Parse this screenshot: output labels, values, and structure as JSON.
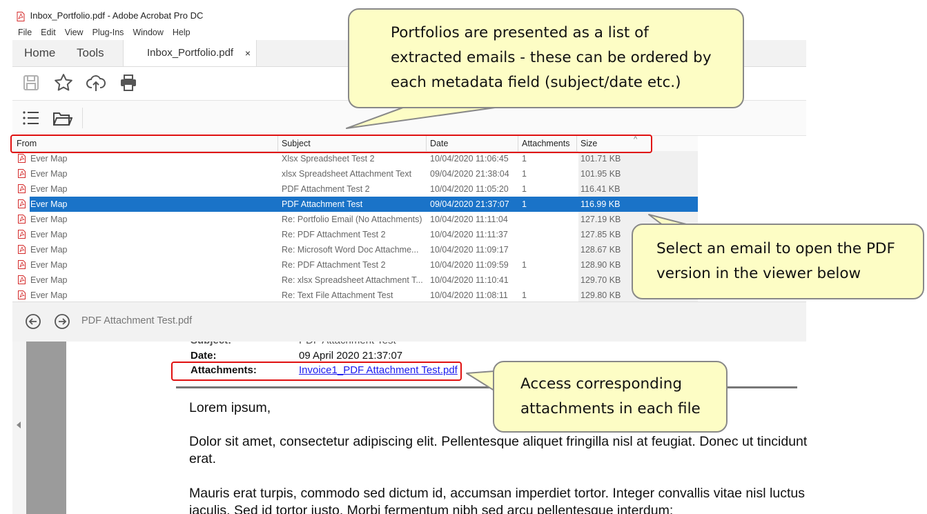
{
  "window": {
    "title": "Inbox_Portfolio.pdf - Adobe Acrobat Pro DC"
  },
  "menu": [
    "File",
    "Edit",
    "View",
    "Plug-Ins",
    "Window",
    "Help"
  ],
  "tabs": {
    "home": "Home",
    "tools": "Tools",
    "document": "Inbox_Portfolio.pdf",
    "close": "×"
  },
  "toolbar_icons": [
    "save-icon",
    "star-icon",
    "upload-cloud-icon",
    "print-icon"
  ],
  "portfolio_icons": [
    "list-view-icon",
    "open-folder-icon"
  ],
  "table": {
    "columns": {
      "from": "From",
      "subject": "Subject",
      "date": "Date",
      "attachments": "Attachments",
      "size": "Size",
      "sort_indicator": "^"
    },
    "rows": [
      {
        "from": "Ever Map",
        "subject": "Xlsx Spreadsheet Test 2",
        "date": "10/04/2020 11:06:45",
        "attachments": "1",
        "size": "101.71 KB"
      },
      {
        "from": "Ever Map",
        "subject": "xlsx Spreadsheet Attachment Text",
        "date": "09/04/2020 21:38:04",
        "attachments": "1",
        "size": "101.95 KB"
      },
      {
        "from": "Ever Map",
        "subject": "PDF Attachment Test 2",
        "date": "10/04/2020 11:05:20",
        "attachments": "1",
        "size": "116.41 KB"
      },
      {
        "from": "Ever Map",
        "subject": "PDF Attachment Test",
        "date": "09/04/2020 21:37:07",
        "attachments": "1",
        "size": "116.99 KB"
      },
      {
        "from": "Ever Map",
        "subject": "Re: Portfolio Email (No Attachments)",
        "date": "10/04/2020 11:11:04",
        "attachments": "",
        "size": "127.19 KB"
      },
      {
        "from": "Ever Map",
        "subject": "Re: PDF Attachment Test 2",
        "date": "10/04/2020 11:11:37",
        "attachments": "",
        "size": "127.85 KB"
      },
      {
        "from": "Ever Map",
        "subject": "Re: Microsoft Word Doc Attachme...",
        "date": "10/04/2020 11:09:17",
        "attachments": "",
        "size": "128.67 KB"
      },
      {
        "from": "Ever Map",
        "subject": "Re: PDF Attachment Test 2",
        "date": "10/04/2020 11:09:59",
        "attachments": "1",
        "size": "128.90 KB"
      },
      {
        "from": "Ever Map",
        "subject": "Re: xlsx Spreadsheet Attachment T...",
        "date": "10/04/2020 11:10:41",
        "attachments": "",
        "size": "129.70 KB"
      },
      {
        "from": "Ever Map",
        "subject": "Re: Text File Attachment Test",
        "date": "10/04/2020 11:08:11",
        "attachments": "1",
        "size": "129.80 KB"
      }
    ],
    "selected_row_index": 3
  },
  "navigation": {
    "file_name": "PDF Attachment Test.pdf"
  },
  "document": {
    "subject_label": "Subject:",
    "subject_value": "PDF Attachment Test",
    "date_label": "Date:",
    "date_value": "09 April 2020 21:37:07",
    "attachments_label": "Attachments:",
    "attachments_link": "Invoice1_PDF Attachment Test.pdf",
    "greeting": "Lorem ipsum,",
    "paragraph1": "Dolor sit amet, consectetur adipiscing elit. Pellentesque aliquet fringilla nisl at feugiat. Donec ut tincidunt erat.",
    "paragraph2": "Mauris erat turpis, commodo sed dictum id, accumsan imperdiet tortor. Integer convallis vitae nisl luctus iaculis. Sed id tortor justo. Morbi fermentum nibh sed arcu pellentesque interdum;"
  },
  "callouts": {
    "metadata": "Portfolios are presented as a list of extracted emails - these can be ordered by each metadata field (subject/date etc.)",
    "select": "Select an email to open the PDF version in the viewer below",
    "attachments": "Access corresponding attachments in each file"
  },
  "colors": {
    "selection": "#1a73c8",
    "callout_fill": "#fdfdc5",
    "highlight_box": "#e01010",
    "link": "#1a1aee"
  }
}
